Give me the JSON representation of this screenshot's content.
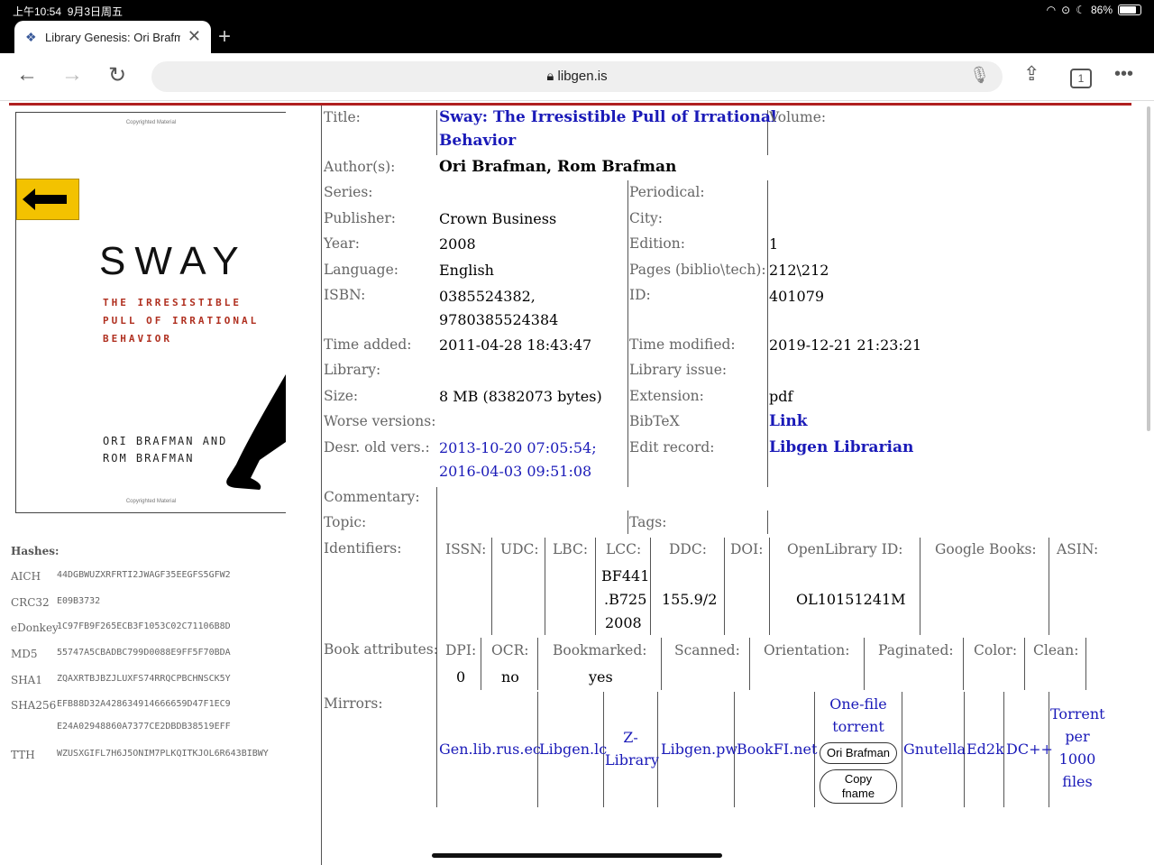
{
  "status_bar": {
    "time": "上午10:54",
    "date": "9月3日周五",
    "battery": "86%"
  },
  "tab": {
    "title": "Library Genesis: Ori Brafman, Rom Brafman"
  },
  "toolbar": {
    "url": "libgen.is",
    "tab_count": "1"
  },
  "cover": {
    "copyright": "Copyrighted Material",
    "title": "SWAY",
    "subtitle": [
      "THE IRRESISTIBLE",
      "PULL OF IRRATIONAL",
      "BEHAVIOR"
    ],
    "authors": [
      "ORI BRAFMAN AND",
      "ROM BRAFMAN"
    ]
  },
  "hashes": {
    "heading": "Hashes:",
    "items": [
      {
        "label": "AICH",
        "value": "44DGBWUZXRFRTI2JWAGF35EEGFS5GFW2"
      },
      {
        "label": "CRC32",
        "value": "E09B3732"
      },
      {
        "label": "eDonkey",
        "value": "1C97FB9F265ECB3F1053C02C71106B8D"
      },
      {
        "label": "MD5",
        "value": "55747A5CBADBC799D0088E9FF5F70BDA"
      },
      {
        "label": "SHA1",
        "value": "ZQAXRTBJBZJLUXFS74RRQCPBCHNSCK5Y"
      },
      {
        "label": "SHA256",
        "value": "EFB88D32A428634914666659D47F1EC9",
        "value2": "E24A02948860A7377CE2DBDB38519EFF"
      },
      {
        "label": "TTH",
        "value": "WZUSXGIFL7H6J5ONIM7PLKQITKJOL6R643BIBWY"
      }
    ]
  },
  "book": {
    "title_label": "Title:",
    "title": [
      "Sway: The Irresistible Pull of Irrational",
      "Behavior"
    ],
    "volume_label": "Volume:",
    "authors_label": "Author(s):",
    "authors": "Ori Brafman, Rom Brafman",
    "series_label": "Series:",
    "periodical_label": "Periodical:",
    "publisher_label": "Publisher:",
    "publisher": "Crown Business",
    "city_label": "City:",
    "year_label": "Year:",
    "year": "2008",
    "edition_label": "Edition:",
    "edition": "1",
    "language_label": "Language:",
    "language": "English",
    "pages_label": "Pages (biblio\\tech):",
    "pages": "212\\212",
    "isbn_label": "ISBN:",
    "isbn": [
      "0385524382,",
      "9780385524384"
    ],
    "id_label": "ID:",
    "id": "401079",
    "time_added_label": "Time added:",
    "time_added": "2011-04-28 18:43:47",
    "time_modified_label": "Time modified:",
    "time_modified": "2019-12-21 21:23:21",
    "library_label": "Library:",
    "library_issue_label": "Library issue:",
    "size_label": "Size:",
    "size": "8 MB (8382073 bytes)",
    "extension_label": "Extension:",
    "extension": "pdf",
    "worse_label": "Worse versions:",
    "bibtex_label": "BibTeX",
    "bibtex_link": "Link",
    "desr_label": "Desr. old vers.:",
    "desr": [
      "2013-10-20 07:05:54;",
      "2016-04-03 09:51:08"
    ],
    "edit_label": "Edit record:",
    "edit_link": "Libgen Librarian",
    "commentary_label": "Commentary:",
    "topic_label": "Topic:",
    "tags_label": "Tags:",
    "identifiers_label": "Identifiers:",
    "identifiers": {
      "issn": "ISSN:",
      "udc": "UDC:",
      "lbc": "LBC:",
      "lcc": "LCC:",
      "lcc_value": [
        "BF441",
        ".B725",
        "2008"
      ],
      "ddc": "DDC:",
      "ddc_value": "155.9/2",
      "doi": "DOI:",
      "openlibrary": "OpenLibrary ID:",
      "openlibrary_value": "OL10151241M",
      "google": "Google Books:",
      "asin": "ASIN:"
    },
    "attributes_label": "Book attributes:",
    "attributes": {
      "dpi": "DPI:",
      "dpi_value": "0",
      "ocr": "OCR:",
      "ocr_value": "no",
      "bookmarked": "Bookmarked:",
      "bookmarked_value": "yes",
      "scanned": "Scanned:",
      "orientation": "Orientation:",
      "paginated": "Paginated:",
      "color": "Color:",
      "clean": "Clean:"
    },
    "mirrors_label": "Mirrors:",
    "mirrors": {
      "genlib": "Gen.lib.rus.ec",
      "libgenlc": "Libgen.lc",
      "zlib": [
        "Z-",
        "Library"
      ],
      "libgenpw": "Libgen.pw",
      "bookfi": "BookFI.net",
      "onefile": [
        "One-file",
        "torrent"
      ],
      "fname_btn": "Ori Brafman",
      "copy_btn": [
        "Copy",
        "fname"
      ],
      "gnutella": "Gnutella",
      "ed2k": "Ed2k",
      "dcpp": "DC++",
      "torrent1000": [
        "Torrent",
        "per",
        "1000",
        "files"
      ]
    }
  }
}
